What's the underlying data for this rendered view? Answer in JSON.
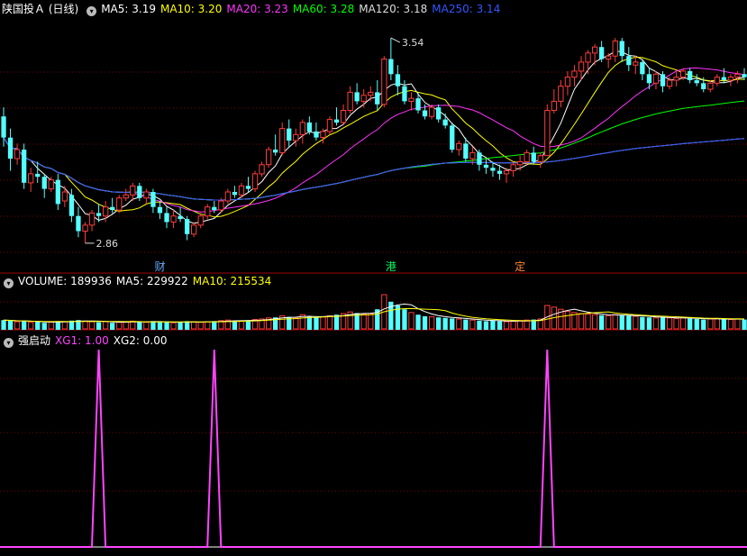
{
  "header": {
    "stock_title": "陕国投Ａ (日线)",
    "ma": [
      {
        "label": "MA5: 3.19",
        "color": "#ffffff"
      },
      {
        "label": "MA10: 3.20",
        "color": "#ffff00"
      },
      {
        "label": "MA20: 3.23",
        "color": "#ff33ff"
      },
      {
        "label": "MA60: 3.28",
        "color": "#00ff00"
      },
      {
        "label": "MA120: 3.18",
        "color": "#dddddd"
      },
      {
        "label": "MA250: 3.14",
        "color": "#3355ff"
      }
    ]
  },
  "volume_header": {
    "title": "VOLUME: 189936",
    "ma5": "MA5: 229922",
    "ma10": "MA10: 215534"
  },
  "indicator_header": {
    "name": "强启动",
    "xg1": "XG1: 1.00",
    "xg2": "XG2: 0.00"
  },
  "markers": [
    {
      "text": "财",
      "index": 23,
      "color": "#66aaff"
    },
    {
      "text": "港",
      "index": 57,
      "color": "#00ff66"
    },
    {
      "text": "定",
      "index": 76,
      "color": "#ff8833"
    }
  ],
  "colors": {
    "up": "#ff3c3c",
    "down": "#54ffff",
    "xg1": "#ff44ff",
    "xg1_label": "#ff44ff"
  },
  "chart_data": [
    {
      "type": "candlestick",
      "title": "陕国投Ａ (日线)",
      "ylim": [
        2.8,
        3.6
      ],
      "annotations": [
        {
          "text": "3.54",
          "value": 3.54,
          "index": 57,
          "kind": "high"
        },
        {
          "text": "2.86",
          "value": 2.86,
          "index": 12,
          "kind": "low"
        }
      ],
      "ohlc": [
        [
          3.28,
          3.31,
          3.18,
          3.21
        ],
        [
          3.21,
          3.24,
          3.1,
          3.14
        ],
        [
          3.14,
          3.19,
          3.12,
          3.17
        ],
        [
          3.17,
          3.19,
          3.04,
          3.06
        ],
        [
          3.06,
          3.11,
          3.03,
          3.09
        ],
        [
          3.09,
          3.13,
          3.06,
          3.08
        ],
        [
          3.08,
          3.09,
          3.01,
          3.04
        ],
        [
          3.04,
          3.08,
          3.03,
          3.07
        ],
        [
          3.07,
          3.09,
          2.97,
          2.99
        ],
        [
          3.0,
          3.05,
          2.98,
          3.03
        ],
        [
          3.02,
          3.04,
          2.93,
          2.95
        ],
        [
          2.95,
          2.98,
          2.88,
          2.9
        ],
        [
          2.9,
          2.93,
          2.86,
          2.92
        ],
        [
          2.92,
          2.97,
          2.9,
          2.96
        ],
        [
          2.96,
          2.99,
          2.93,
          2.95
        ],
        [
          2.95,
          3.0,
          2.93,
          2.98
        ],
        [
          2.98,
          3.01,
          2.96,
          2.97
        ],
        [
          2.97,
          3.02,
          2.96,
          3.01
        ],
        [
          3.01,
          3.04,
          3.0,
          3.02
        ],
        [
          3.02,
          3.06,
          3.0,
          3.05
        ],
        [
          3.05,
          3.06,
          3.0,
          3.01
        ],
        [
          3.01,
          3.04,
          2.99,
          3.03
        ],
        [
          3.03,
          3.04,
          2.96,
          2.98
        ],
        [
          2.98,
          3.0,
          2.94,
          2.96
        ],
        [
          2.96,
          2.98,
          2.91,
          2.93
        ],
        [
          2.93,
          2.97,
          2.91,
          2.95
        ],
        [
          2.95,
          2.98,
          2.93,
          2.94
        ],
        [
          2.94,
          2.95,
          2.87,
          2.89
        ],
        [
          2.89,
          2.93,
          2.88,
          2.92
        ],
        [
          2.92,
          2.96,
          2.91,
          2.95
        ],
        [
          2.95,
          2.99,
          2.94,
          2.98
        ],
        [
          2.98,
          3.0,
          2.96,
          2.97
        ],
        [
          2.97,
          3.01,
          2.96,
          3.0
        ],
        [
          3.0,
          3.04,
          2.99,
          3.03
        ],
        [
          3.03,
          3.05,
          3.01,
          3.02
        ],
        [
          3.02,
          3.06,
          3.01,
          3.05
        ],
        [
          3.05,
          3.08,
          3.03,
          3.04
        ],
        [
          3.04,
          3.1,
          3.03,
          3.09
        ],
        [
          3.09,
          3.13,
          3.08,
          3.12
        ],
        [
          3.12,
          3.18,
          3.11,
          3.17
        ],
        [
          3.17,
          3.22,
          3.15,
          3.16
        ],
        [
          3.16,
          3.26,
          3.15,
          3.24
        ],
        [
          3.24,
          3.27,
          3.18,
          3.2
        ],
        [
          3.2,
          3.24,
          3.18,
          3.22
        ],
        [
          3.22,
          3.27,
          3.19,
          3.26
        ],
        [
          3.26,
          3.28,
          3.22,
          3.23
        ],
        [
          3.23,
          3.26,
          3.2,
          3.21
        ],
        [
          3.21,
          3.24,
          3.19,
          3.23
        ],
        [
          3.23,
          3.28,
          3.22,
          3.27
        ],
        [
          3.27,
          3.31,
          3.25,
          3.26
        ],
        [
          3.26,
          3.32,
          3.25,
          3.3
        ],
        [
          3.3,
          3.38,
          3.29,
          3.36
        ],
        [
          3.36,
          3.39,
          3.32,
          3.33
        ],
        [
          3.33,
          3.37,
          3.31,
          3.35
        ],
        [
          3.35,
          3.38,
          3.33,
          3.36
        ],
        [
          3.36,
          3.4,
          3.3,
          3.32
        ],
        [
          3.32,
          3.48,
          3.31,
          3.47
        ],
        [
          3.47,
          3.54,
          3.4,
          3.42
        ],
        [
          3.42,
          3.45,
          3.35,
          3.38
        ],
        [
          3.38,
          3.4,
          3.32,
          3.33
        ],
        [
          3.33,
          3.36,
          3.3,
          3.34
        ],
        [
          3.34,
          3.36,
          3.29,
          3.3
        ],
        [
          3.3,
          3.32,
          3.27,
          3.28
        ],
        [
          3.28,
          3.32,
          3.27,
          3.31
        ],
        [
          3.31,
          3.32,
          3.26,
          3.27
        ],
        [
          3.27,
          3.29,
          3.24,
          3.25
        ],
        [
          3.25,
          3.26,
          3.16,
          3.17
        ],
        [
          3.17,
          3.2,
          3.15,
          3.19
        ],
        [
          3.19,
          3.21,
          3.13,
          3.14
        ],
        [
          3.14,
          3.18,
          3.12,
          3.16
        ],
        [
          3.16,
          3.17,
          3.1,
          3.12
        ],
        [
          3.12,
          3.14,
          3.09,
          3.11
        ],
        [
          3.11,
          3.13,
          3.08,
          3.1
        ],
        [
          3.1,
          3.12,
          3.07,
          3.09
        ],
        [
          3.09,
          3.11,
          3.06,
          3.1
        ],
        [
          3.1,
          3.13,
          3.08,
          3.12
        ],
        [
          3.12,
          3.15,
          3.1,
          3.13
        ],
        [
          3.13,
          3.17,
          3.12,
          3.16
        ],
        [
          3.16,
          3.18,
          3.12,
          3.13
        ],
        [
          3.13,
          3.16,
          3.11,
          3.15
        ],
        [
          3.15,
          3.32,
          3.26,
          3.3
        ],
        [
          3.3,
          3.37,
          3.29,
          3.33
        ],
        [
          3.33,
          3.4,
          3.31,
          3.38
        ],
        [
          3.38,
          3.43,
          3.35,
          3.41
        ],
        [
          3.41,
          3.45,
          3.38,
          3.43
        ],
        [
          3.43,
          3.48,
          3.4,
          3.46
        ],
        [
          3.46,
          3.5,
          3.42,
          3.49
        ],
        [
          3.49,
          3.52,
          3.45,
          3.51
        ],
        [
          3.51,
          3.53,
          3.46,
          3.47
        ],
        [
          3.47,
          3.49,
          3.44,
          3.48
        ],
        [
          3.48,
          3.54,
          3.46,
          3.53
        ],
        [
          3.53,
          3.54,
          3.46,
          3.48
        ],
        [
          3.48,
          3.51,
          3.43,
          3.45
        ],
        [
          3.45,
          3.48,
          3.42,
          3.46
        ],
        [
          3.46,
          3.47,
          3.4,
          3.42
        ],
        [
          3.42,
          3.44,
          3.37,
          3.39
        ],
        [
          3.39,
          3.43,
          3.37,
          3.42
        ],
        [
          3.42,
          3.43,
          3.36,
          3.38
        ],
        [
          3.38,
          3.41,
          3.37,
          3.4
        ],
        [
          3.4,
          3.43,
          3.38,
          3.41
        ],
        [
          3.41,
          3.44,
          3.4,
          3.43
        ],
        [
          3.43,
          3.44,
          3.39,
          3.4
        ],
        [
          3.4,
          3.42,
          3.38,
          3.39
        ],
        [
          3.39,
          3.41,
          3.36,
          3.37
        ],
        [
          3.37,
          3.4,
          3.36,
          3.39
        ],
        [
          3.39,
          3.42,
          3.38,
          3.41
        ],
        [
          3.41,
          3.44,
          3.39,
          3.4
        ],
        [
          3.4,
          3.42,
          3.38,
          3.41
        ],
        [
          3.41,
          3.43,
          3.39,
          3.42
        ],
        [
          3.42,
          3.44,
          3.4,
          3.41
        ]
      ]
    },
    {
      "type": "bar",
      "title": "VOLUME",
      "ylim": [
        0,
        800000
      ],
      "values": [
        180000,
        170000,
        150000,
        160000,
        140000,
        150000,
        130000,
        140000,
        160000,
        150000,
        170000,
        180000,
        160000,
        150000,
        140000,
        150000,
        130000,
        140000,
        150000,
        160000,
        150000,
        140000,
        160000,
        150000,
        140000,
        130000,
        140000,
        160000,
        150000,
        140000,
        150000,
        160000,
        170000,
        180000,
        170000,
        160000,
        180000,
        190000,
        200000,
        220000,
        230000,
        260000,
        240000,
        220000,
        280000,
        250000,
        230000,
        240000,
        260000,
        280000,
        300000,
        330000,
        310000,
        290000,
        300000,
        380000,
        650000,
        520000,
        450000,
        380000,
        320000,
        280000,
        250000,
        240000,
        230000,
        220000,
        210000,
        200000,
        190000,
        180000,
        170000,
        160000,
        170000,
        160000,
        150000,
        160000,
        170000,
        180000,
        190000,
        200000,
        450000,
        420000,
        380000,
        340000,
        320000,
        300000,
        290000,
        280000,
        270000,
        260000,
        280000,
        270000,
        260000,
        250000,
        240000,
        230000,
        220000,
        230000,
        220000,
        210000,
        220000,
        210000,
        200000,
        190000,
        200000,
        210000,
        200000,
        190000,
        200000,
        189936
      ]
    },
    {
      "type": "line",
      "title": "强启动",
      "ylim": [
        0,
        1
      ],
      "series": [
        {
          "name": "XG1",
          "spikes": [
            14,
            31,
            80
          ]
        }
      ]
    }
  ]
}
